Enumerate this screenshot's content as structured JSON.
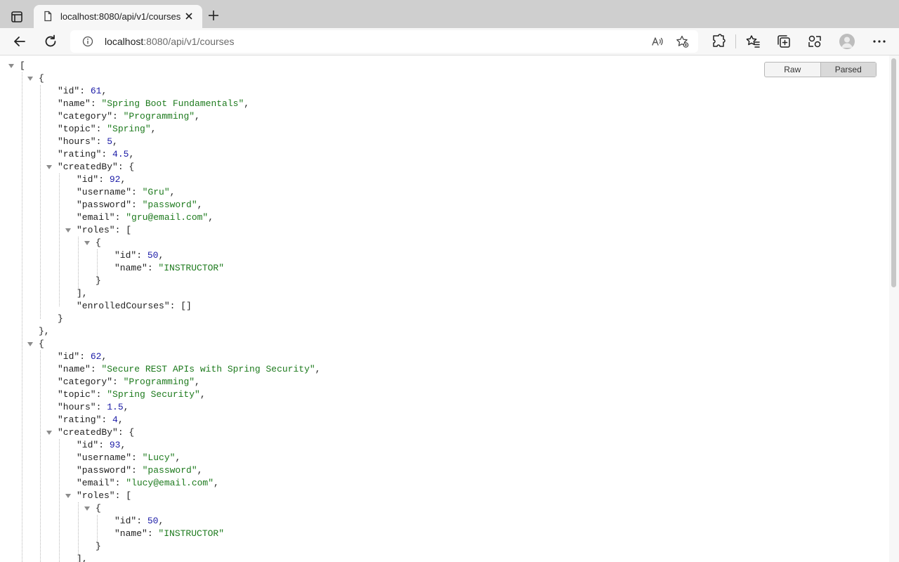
{
  "browser": {
    "tab": {
      "title": "localhost:8080/api/v1/courses"
    },
    "address": {
      "host": "localhost",
      "path": ":8080/api/v1/courses"
    }
  },
  "viewer": {
    "raw_label": "Raw",
    "parsed_label": "Parsed",
    "mode": "Parsed"
  },
  "json": {
    "courses": [
      {
        "id": "61",
        "name": "\"Spring Boot Fundamentals\"",
        "category": "\"Programming\"",
        "topic": "\"Spring\"",
        "hours": "5",
        "rating": "4.5",
        "createdBy": {
          "id": "92",
          "username": "\"Gru\"",
          "password": "\"password\"",
          "email": "\"gru@email.com\"",
          "role": {
            "id": "50",
            "name": "\"INSTRUCTOR\""
          },
          "enrolledCourses": "[]"
        }
      },
      {
        "id": "62",
        "name": "\"Secure REST APIs with Spring Security\"",
        "category": "\"Programming\"",
        "topic": "\"Spring Security\"",
        "hours": "1.5",
        "rating": "4",
        "createdBy": {
          "id": "93",
          "username": "\"Lucy\"",
          "password": "\"password\"",
          "email": "\"lucy@email.com\"",
          "role": {
            "id": "50",
            "name": "\"INSTRUCTOR\""
          }
        }
      }
    ]
  }
}
